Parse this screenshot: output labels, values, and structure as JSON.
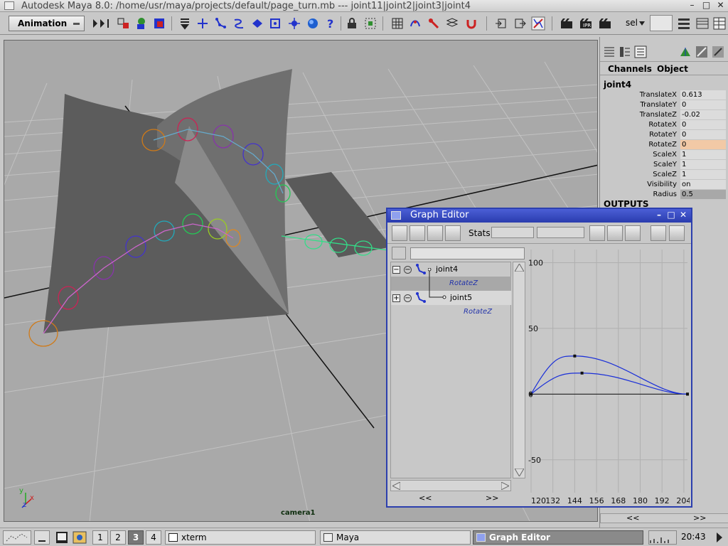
{
  "window": {
    "title": "Autodesk Maya 8.0: /home/usr/maya/projects/default/page_turn.mb   ---   joint11|joint2|joint3|joint4",
    "minimize": "–",
    "maximize": "□",
    "close": "✕"
  },
  "toolbar": {
    "mode": "Animation",
    "sel_label": "sel",
    "icons": [
      "select-by-hierarchy-icon",
      "select-by-object-icon",
      "select-by-component-icon",
      "snap-grid-icon",
      "snap-curve-icon",
      "snap-point-icon",
      "snap-view-icon",
      "make-live-icon",
      "history-icon",
      "render-icon",
      "ipr-render-icon",
      "render-settings-icon",
      "lock-icon",
      "unlock-icon",
      "magnet-icon",
      "input-output-icon",
      "show-manipulator-icon",
      "sel-field-icon",
      "channel-box-icon"
    ],
    "accent": "#2233cc"
  },
  "viewport": {
    "camera": "camera1",
    "axis_x": "x",
    "axis_y": "y",
    "axis_z": "z"
  },
  "channel_box": {
    "menu_channels": "Channels",
    "menu_object": "Object",
    "object": "joint4",
    "attributes": [
      {
        "name": "TranslateX",
        "value": "0.613"
      },
      {
        "name": "TranslateY",
        "value": "0"
      },
      {
        "name": "TranslateZ",
        "value": "-0.02"
      },
      {
        "name": "RotateX",
        "value": "0"
      },
      {
        "name": "RotateY",
        "value": "0"
      },
      {
        "name": "RotateZ",
        "value": "0"
      },
      {
        "name": "ScaleX",
        "value": "1"
      },
      {
        "name": "ScaleY",
        "value": "1"
      },
      {
        "name": "ScaleZ",
        "value": "1"
      },
      {
        "name": "Visibility",
        "value": "on"
      },
      {
        "name": "Radius",
        "value": "0.5"
      }
    ],
    "outputs": "OUTPUTS",
    "scroll_left": "<<",
    "scroll_right": ">>"
  },
  "graph_editor": {
    "title": "Graph Editor",
    "stats": "Stats",
    "outliner": [
      {
        "name": "joint4",
        "curve": "RotateZ",
        "expanded": true
      },
      {
        "name": "joint5",
        "curve": "RotateZ",
        "expanded": false
      }
    ],
    "scroll_left": "<<",
    "scroll_right": ">>"
  },
  "chart_data": {
    "type": "line",
    "title": "",
    "xlabel": "",
    "ylabel": "",
    "xlim": [
      120,
      206
    ],
    "ylim": [
      -75,
      110
    ],
    "x_ticks": [
      "120",
      "132",
      "144",
      "156",
      "168",
      "180",
      "192",
      "204"
    ],
    "y_ticks": [
      "100",
      "50",
      "0",
      "-50"
    ],
    "series": [
      {
        "x": [
          120,
          144,
          206
        ],
        "y": [
          0,
          29,
          0
        ]
      },
      {
        "x": [
          120,
          148,
          206
        ],
        "y": [
          0,
          16,
          0
        ]
      }
    ],
    "grid": true
  },
  "taskbar": {
    "desktops": [
      "1",
      "2",
      "3",
      "4"
    ],
    "active_desktop": "3",
    "tasks": [
      {
        "label": "xterm"
      },
      {
        "label": "Maya"
      },
      {
        "label": "Graph Editor"
      }
    ],
    "clock": "20:43"
  }
}
